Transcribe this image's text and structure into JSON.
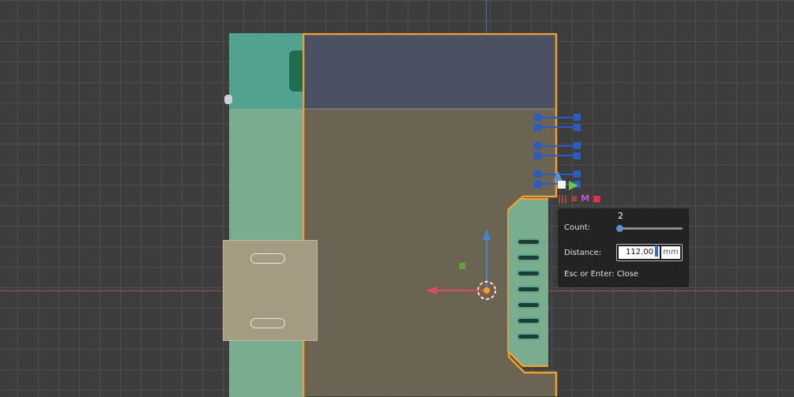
{
  "viewport": {
    "label": "3d-viewport"
  },
  "operator_icons": [
    {
      "name": "array-icon",
      "glyph": "|||",
      "color": "#e0503a"
    },
    {
      "name": "lines-icon",
      "glyph": "≡",
      "color": "#e0503a"
    },
    {
      "name": "material-icon",
      "glyph": "M",
      "color": "#d24fd2"
    },
    {
      "name": "square-icon",
      "glyph": "■",
      "color": "#e03050"
    }
  ],
  "redo_panel": {
    "count_label": "Count:",
    "count_value": "2",
    "count_fraction": 0.0,
    "distance_label": "Distance:",
    "distance_value": "112.00",
    "distance_unit": "mm",
    "hint": "Esc or Enter: Close"
  },
  "colors": {
    "selection_outline": "#f0a030",
    "grid": "#4e4e4e",
    "x_axis": "#b04a55",
    "y_axis": "#3a78c8",
    "body": "#6b6452",
    "top_panel": "#4b5063",
    "teal": "#52a292"
  }
}
